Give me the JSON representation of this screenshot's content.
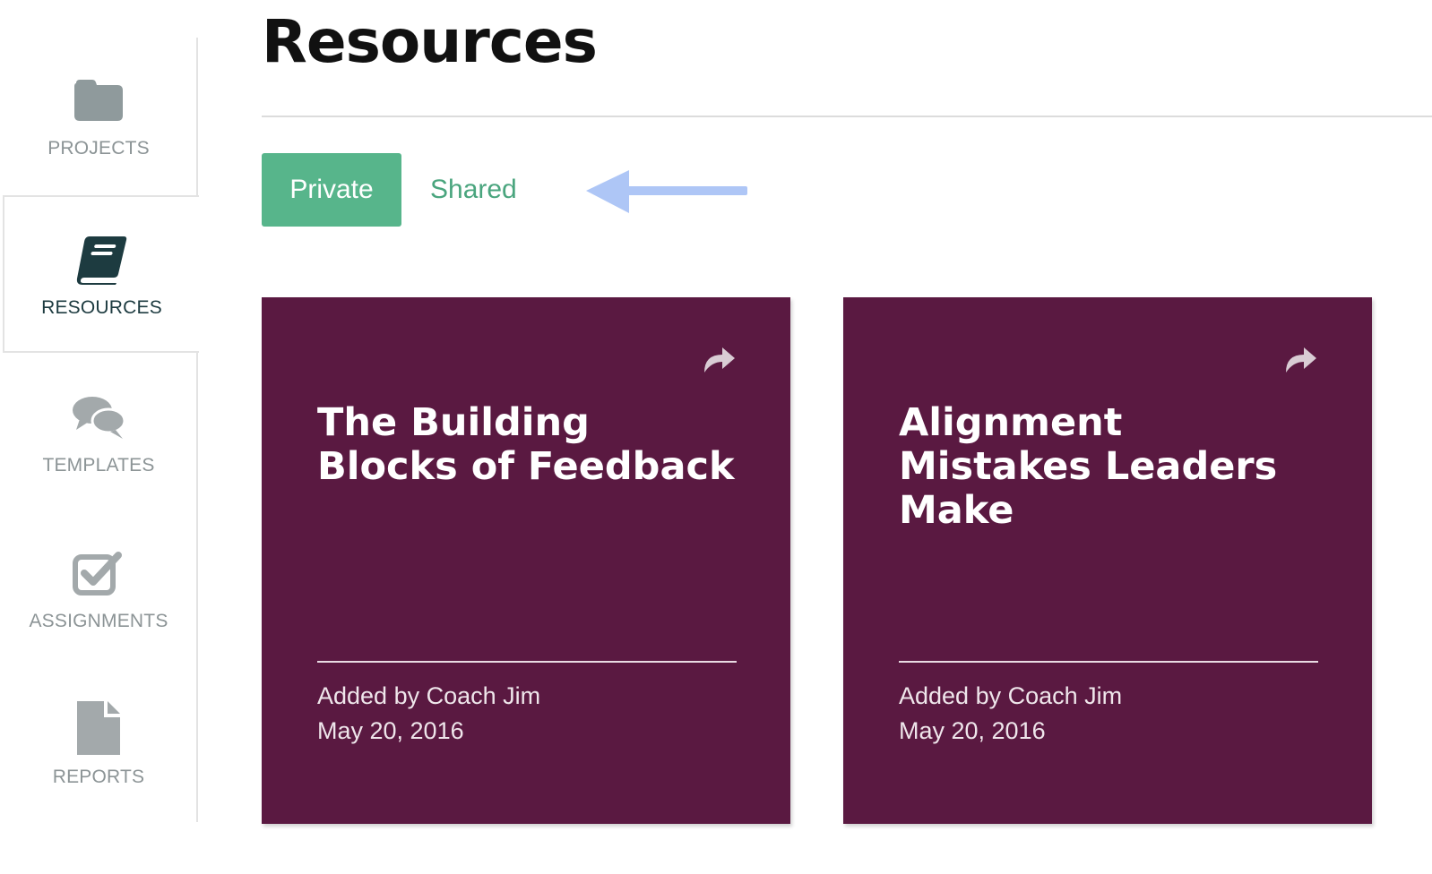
{
  "sidebar": {
    "items": [
      {
        "label": "PROJECTS",
        "icon": "folder-icon"
      },
      {
        "label": "RESOURCES",
        "icon": "book-icon",
        "active": true
      },
      {
        "label": "TEMPLATES",
        "icon": "chat-bubbles-icon"
      },
      {
        "label": "ASSIGNMENTS",
        "icon": "checkbox-icon"
      },
      {
        "label": "REPORTS",
        "icon": "document-icon"
      }
    ]
  },
  "main": {
    "title": "Resources",
    "tabs": [
      {
        "label": "Private",
        "active": true
      },
      {
        "label": "Shared",
        "active": false
      }
    ],
    "cards": [
      {
        "title": "The Building Blocks of Feedback",
        "author": "Added by Coach Jim",
        "date": "May 20, 2016",
        "icon": "share-icon"
      },
      {
        "title": "Alignment Mistakes Leaders Make",
        "author": "Added by Coach Jim",
        "date": "May 20, 2016",
        "icon": "share-icon"
      }
    ]
  },
  "colors": {
    "accent_green": "#57b58b",
    "card_background": "#5a1941",
    "annotation_arrow": "#aec6f6",
    "active_nav": "#1d3b40",
    "inactive_nav": "#8c9496"
  }
}
